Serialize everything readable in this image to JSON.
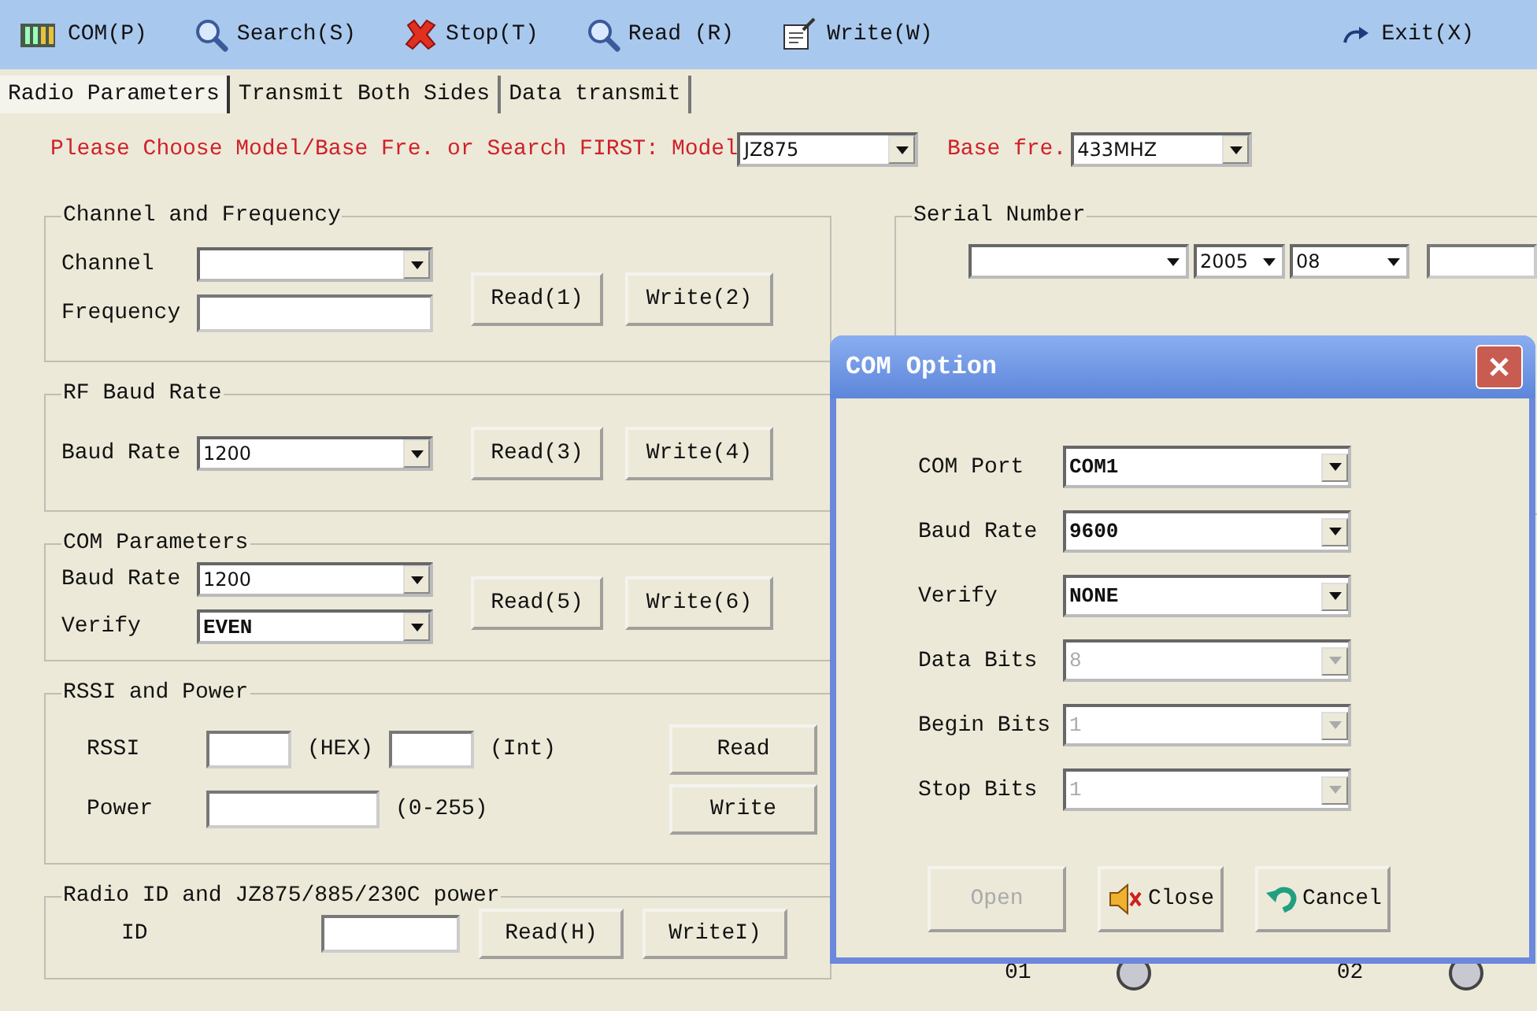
{
  "toolbar": [
    {
      "label": "COM(P)",
      "kind": "com"
    },
    {
      "label": "Search(S)",
      "kind": "search"
    },
    {
      "label": "Stop(T)",
      "kind": "stop"
    },
    {
      "label": "Read (R)",
      "kind": "search"
    },
    {
      "label": "Write(W)",
      "kind": "write"
    },
    {
      "label": "Exit(X)",
      "kind": "exit"
    }
  ],
  "tabs": [
    {
      "label": "Radio Parameters",
      "selected": true
    },
    {
      "label": "Transmit Both Sides",
      "selected": false
    },
    {
      "label": "Data transmit",
      "selected": false
    }
  ],
  "model_row": {
    "prompt": "Please Choose Model/Base Fre. or Search FIRST:",
    "model_label": "Model",
    "model_value": "JZ875",
    "base_label": "Base fre.",
    "base_value": "433MHZ"
  },
  "channel_frequency": {
    "title": "Channel and Frequency",
    "channel_label": "Channel",
    "frequency_label": "Frequency",
    "buttons": [
      "Read(1)",
      "Write(2)"
    ]
  },
  "rf_baud_rate": {
    "title": "RF Baud Rate",
    "baud_label": "Baud Rate",
    "baud_value": "1200",
    "buttons": [
      "Read(3)",
      "Write(4)"
    ]
  },
  "com_parameters": {
    "title": "COM Parameters",
    "baud_label": "Baud Rate",
    "baud_value": "1200",
    "verify_label": "Verify",
    "verify_value": "EVEN",
    "buttons": [
      "Read(5)",
      "Write(6)"
    ]
  },
  "rssi_power": {
    "title": "RSSI and Power",
    "rssi_label": "RSSI",
    "hex_unit": "(HEX)",
    "int_unit": "(Int)",
    "power_label": "Power",
    "power_range": "(0-255)",
    "buttons": [
      "Read",
      "Write"
    ]
  },
  "radio_id": {
    "title": "Radio ID and JZ875/885/230C power",
    "id_label": "ID",
    "buttons": [
      "Read(H)",
      "WriteI)"
    ]
  },
  "serial_number": {
    "title": "Serial Number",
    "year": "2005",
    "month": "08"
  },
  "indicators": [
    {
      "label": "01"
    },
    {
      "label": "02"
    }
  ],
  "dialog": {
    "title": "COM Option",
    "fields": [
      {
        "label": "COM Port",
        "value": "COM1",
        "disabled": false
      },
      {
        "label": "Baud Rate",
        "value": "9600",
        "disabled": false
      },
      {
        "label": "Verify",
        "value": "NONE",
        "disabled": false
      },
      {
        "label": "Data Bits",
        "value": "8",
        "disabled": true
      },
      {
        "label": "Begin Bits",
        "value": "1",
        "disabled": true
      },
      {
        "label": "Stop Bits",
        "value": "1",
        "disabled": true
      }
    ],
    "buttons": [
      {
        "label": "Open",
        "kind": "plain",
        "disabled": true
      },
      {
        "label": "Close",
        "kind": "close",
        "disabled": false
      },
      {
        "label": "Cancel",
        "kind": "cancel",
        "disabled": false
      }
    ]
  }
}
